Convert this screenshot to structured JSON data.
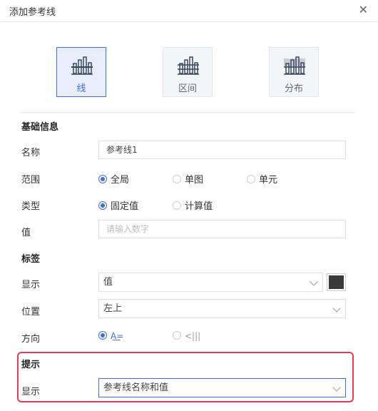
{
  "dialog": {
    "title": "添加参考线",
    "close_icon": "close-icon"
  },
  "types": [
    {
      "label": "线",
      "icon": "bar-chart-line-icon",
      "active": true
    },
    {
      "label": "区间",
      "icon": "bar-chart-range-icon",
      "active": false
    },
    {
      "label": "分布",
      "icon": "bar-chart-distribution-icon",
      "active": false
    }
  ],
  "basic": {
    "section": "基础信息",
    "name_label": "名称",
    "name_value": "参考线1",
    "scope_label": "范围",
    "scope_options": [
      "全局",
      "单图",
      "单元"
    ],
    "scope_selected": "全局",
    "type_label": "类型",
    "type_options": [
      "固定值",
      "计算值"
    ],
    "type_selected": "固定值",
    "value_label": "值",
    "value_placeholder": "请输入数字"
  },
  "label_section": {
    "section": "标签",
    "display_label": "显示",
    "display_value": "值",
    "color": "#3a3a3a",
    "position_label": "位置",
    "position_value": "左上",
    "direction_label": "方向",
    "direction_selected": "horizontal"
  },
  "tip": {
    "section": "提示",
    "display_label": "显示",
    "display_value": "参考线名称和值",
    "highlight_color": "#e23c52"
  },
  "accent_color": "#3d6fe0"
}
